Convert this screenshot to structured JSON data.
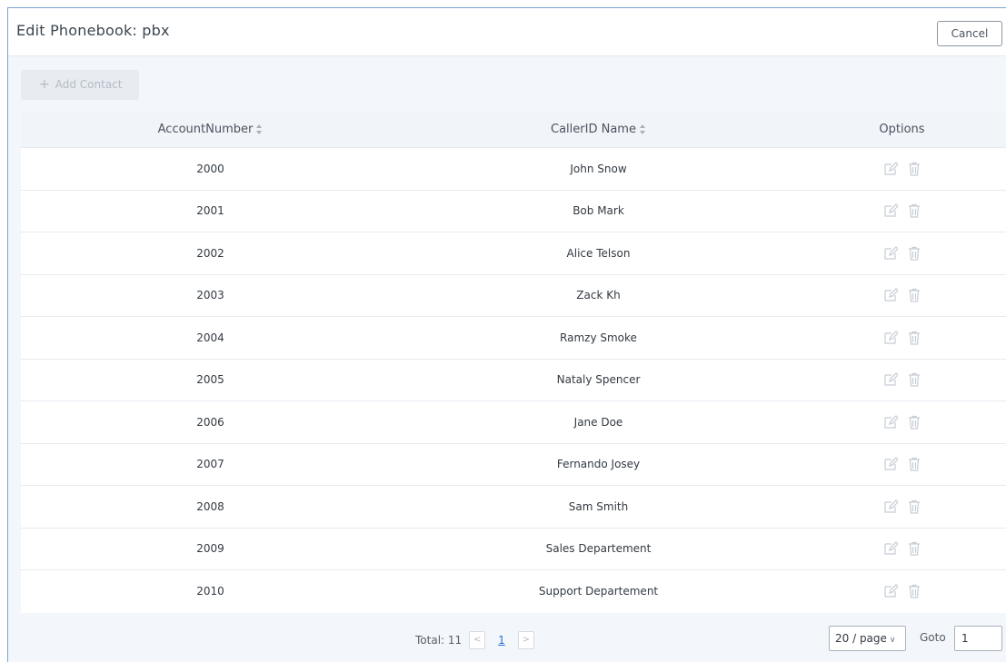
{
  "header": {
    "title": "Edit Phonebook: pbx",
    "cancel_label": "Cancel"
  },
  "toolbar": {
    "add_contact_label": "Add Contact"
  },
  "table": {
    "columns": [
      "AccountNumber",
      "CallerID Name",
      "Options"
    ],
    "rows": [
      {
        "account": "2000",
        "name": "John Snow"
      },
      {
        "account": "2001",
        "name": "Bob Mark"
      },
      {
        "account": "2002",
        "name": "Alice Telson"
      },
      {
        "account": "2003",
        "name": "Zack Kh"
      },
      {
        "account": "2004",
        "name": "Ramzy Smoke"
      },
      {
        "account": "2005",
        "name": "Nataly Spencer"
      },
      {
        "account": "2006",
        "name": "Jane Doe"
      },
      {
        "account": "2007",
        "name": "Fernando Josey"
      },
      {
        "account": "2008",
        "name": "Sam Smith"
      },
      {
        "account": "2009",
        "name": "Sales Departement"
      },
      {
        "account": "2010",
        "name": "Support Departement"
      }
    ],
    "row_icons": [
      "edit-icon",
      "trash-icon"
    ]
  },
  "pagination": {
    "total_label": "Total: 11",
    "current_page": "1",
    "page_size_value": "20 / page",
    "goto_label": "Goto",
    "goto_value": "1"
  },
  "colors": {
    "accent": "#2b6fd6",
    "border": "#7ba3d6",
    "icon": "#c6ccd4"
  }
}
